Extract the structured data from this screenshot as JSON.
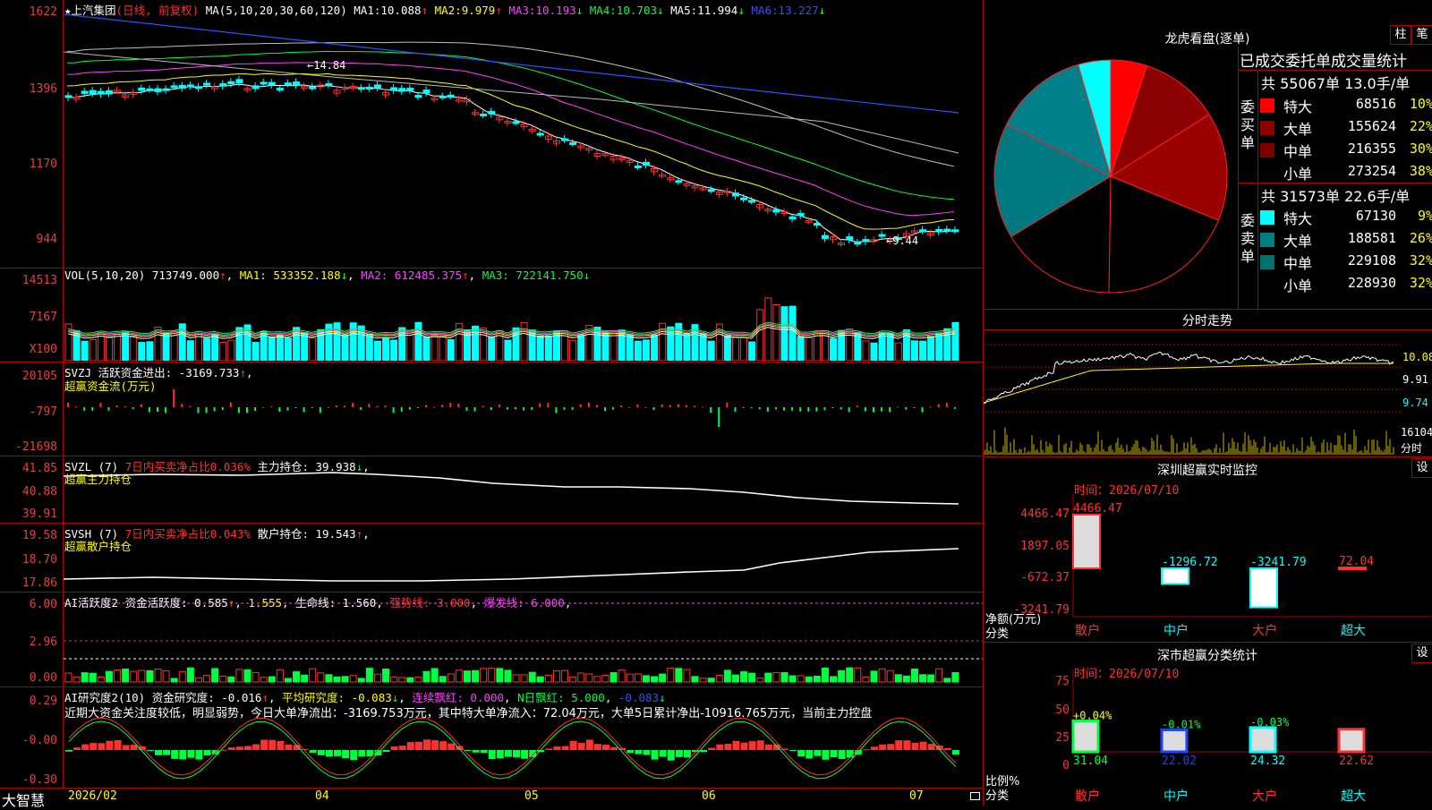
{
  "colors": {
    "up": "#ff3030",
    "down": "#00ffff",
    "frame": "#aa0000",
    "ma1": "#ffffff",
    "ma2": "#ffff00",
    "ma3": "#ff40ff",
    "ma4": "#00ff40",
    "ma5": "#c0c0c0",
    "ma6": "#3050ff"
  },
  "kline": {
    "stock_name": "上汽集团",
    "mode": "(日线, 前复权)",
    "ma_params": "MA(5,10,20,30,60,120)",
    "ma": [
      {
        "label": "MA1:",
        "value": "10.088",
        "arrow": "↑"
      },
      {
        "label": "MA2:",
        "value": "9.979",
        "arrow": "↑"
      },
      {
        "label": "MA3:",
        "value": "10.193",
        "arrow": "↓"
      },
      {
        "label": "MA4:",
        "value": "10.703",
        "arrow": "↓"
      },
      {
        "label": "MA5:",
        "value": "11.994",
        "arrow": "↓"
      },
      {
        "label": "MA6:",
        "value": "13.227",
        "arrow": "↓"
      }
    ],
    "y_labels": [
      "1622",
      "1396",
      "1170",
      "944"
    ],
    "high_mark": "←14.84",
    "low_mark": "←9.44"
  },
  "vol": {
    "title": "VOL(5,10,20)",
    "value": "713749.000",
    "arrow": "↑",
    "ma1": "533352.188",
    "ma2": "612485.375",
    "ma3": "722141.750",
    "ma1_label": "MA1:",
    "ma2_label": "MA2:",
    "ma3_label": "MA3:",
    "ma1_arrow": "↓",
    "ma2_arrow": "↑",
    "ma3_arrow": "↓",
    "y_labels": [
      "14513",
      "7167",
      "X100"
    ]
  },
  "svzj": {
    "title": "SVZJ",
    "label": "活跃资金进出:",
    "value": "-3169.733",
    "arrow": "↑",
    "sub": "超赢资金流(万元)",
    "y_labels": [
      "20105",
      "-797",
      "-21698"
    ]
  },
  "svzl": {
    "title": "SVZL (7)",
    "label1": "7日内买卖净占比",
    "v1": "0.036%",
    "label2": "主力持仓:",
    "v2": "39.938",
    "arrow": "↓",
    "sub": "超赢主力持仓",
    "y_labels": [
      "41.85",
      "40.88",
      "39.91"
    ]
  },
  "svsh": {
    "title": "SVSH (7)",
    "label1": "7日内买卖净占比",
    "v1": "0.043%",
    "label2": "散户持仓:",
    "v2": "19.543",
    "arrow": "↑",
    "sub": "超赢散户持仓",
    "y_labels": [
      "19.58",
      "18.70",
      "17.86"
    ]
  },
  "ai1": {
    "title": "AI活跃度2",
    "label": "资金活跃度:",
    "v1": "0.585",
    "v2": "1.555",
    "l3": "生命线:",
    "v3": "1.560",
    "l4": "强势线:",
    "v4": "3.000",
    "l5": "爆发线:",
    "v5": "6.000",
    "y_labels": [
      "6.00",
      "2.96",
      "0.00"
    ]
  },
  "ai2": {
    "title": "AI研究度2(10)",
    "l1": "资金研究度:",
    "v1": "-0.016",
    "l2": "平均研究度:",
    "v2": "-0.083",
    "l3": "连续飘红:",
    "v3": "0.000",
    "l4": "N日飘红:",
    "v4": "5.000",
    "v5": "-0.083",
    "comment": "近期大资金关注度较低，明显弱势，今日大单净流出：-3169.753万元，其中特大单净流入：72.04万元，大单5日累计净出-10916.765万元，当前主力控盘",
    "y_labels": [
      "0.29",
      "-0.00",
      "-0.30"
    ]
  },
  "xaxis": [
    "2026/02",
    "04",
    "05",
    "06",
    "07"
  ],
  "brand": "大智慧",
  "dragon": {
    "title": "龙虎看盘(逐单)",
    "btn1": "柱",
    "btn2": "笔",
    "header": "已成交委托单成交量统计",
    "buy": {
      "side": "委买单",
      "total": "共 55067单 13.0手/单",
      "rows": [
        {
          "label": "特大",
          "value": "68516",
          "pct": "10%",
          "color": "#ff0000"
        },
        {
          "label": "大单",
          "value": "155624",
          "pct": "22%",
          "color": "#900000"
        },
        {
          "label": "中单",
          "value": "216355",
          "pct": "30%",
          "color": "#800000"
        },
        {
          "label": "小单",
          "value": "273254",
          "pct": "38%",
          "color": "#000000"
        }
      ]
    },
    "sell": {
      "side": "委卖单",
      "total": "共 31573单 22.6手/单",
      "rows": [
        {
          "label": "特大",
          "value": "67130",
          "pct": "9%",
          "color": "#00ffff"
        },
        {
          "label": "大单",
          "value": "188581",
          "pct": "26%",
          "color": "#008080"
        },
        {
          "label": "中单",
          "value": "229108",
          "pct": "32%",
          "color": "#007070"
        },
        {
          "label": "小单",
          "value": "228930",
          "pct": "32%",
          "color": "#000000"
        }
      ]
    },
    "pie": [
      {
        "v": 10,
        "c": "#ff0000"
      },
      {
        "v": 22,
        "c": "#8b0000"
      },
      {
        "v": 30,
        "c": "#990000"
      },
      {
        "v": 38,
        "c": "#000000"
      },
      {
        "v": 32,
        "c": "#000000"
      },
      {
        "v": 32,
        "c": "#007a80"
      },
      {
        "v": 26,
        "c": "#00808a"
      },
      {
        "v": 9,
        "c": "#00ffff"
      }
    ]
  },
  "intraday": {
    "title": "分时走势",
    "y_labels": [
      "10.08",
      "9.91",
      "9.74"
    ],
    "vol_label": "16104",
    "vol_unit": "分时"
  },
  "monitor": {
    "title": "深圳超赢实时监控",
    "btn": "设",
    "time": "时间：2026/07/10",
    "y_labels": [
      "4466.47",
      "1897.05",
      "-672.37",
      "-3241.79"
    ],
    "unit1": "净额(万元)",
    "unit2": "分类",
    "bars": [
      {
        "cat": "散户",
        "value": "4466.47",
        "num": 4466.47,
        "color": "#ff3030"
      },
      {
        "cat": "中户",
        "value": "-1296.72",
        "num": -1296.72,
        "color": "#00ffff"
      },
      {
        "cat": "大户",
        "value": "-3241.79",
        "num": -3241.79,
        "color": "#00ffff"
      },
      {
        "cat": "超大",
        "value": "72.04",
        "num": 72.04,
        "color": "#ff3030"
      }
    ]
  },
  "classify": {
    "title": "深市超赢分类统计",
    "btn": "设",
    "time": "时间：2026/07/10",
    "y_labels": [
      "75",
      "50",
      "25",
      "0"
    ],
    "unit1": "比例%",
    "unit2": "分类",
    "bars": [
      {
        "cat": "散户",
        "pct": "31.04",
        "change": "+0.04%",
        "num": 31.04,
        "color": "#00ff40",
        "cc": "#ffff00"
      },
      {
        "cat": "中户",
        "pct": "22.02",
        "change": "-0.01%",
        "num": 22.02,
        "color": "#2040ff",
        "cc": "#00ff40"
      },
      {
        "cat": "大户",
        "pct": "24.32",
        "change": "-0.03%",
        "num": 24.32,
        "color": "#00ffff",
        "cc": "#00ff40"
      },
      {
        "cat": "超大",
        "pct": "22.62",
        "change": "",
        "num": 22.62,
        "color": "#ff3030",
        "cc": "#ffff00"
      }
    ]
  }
}
